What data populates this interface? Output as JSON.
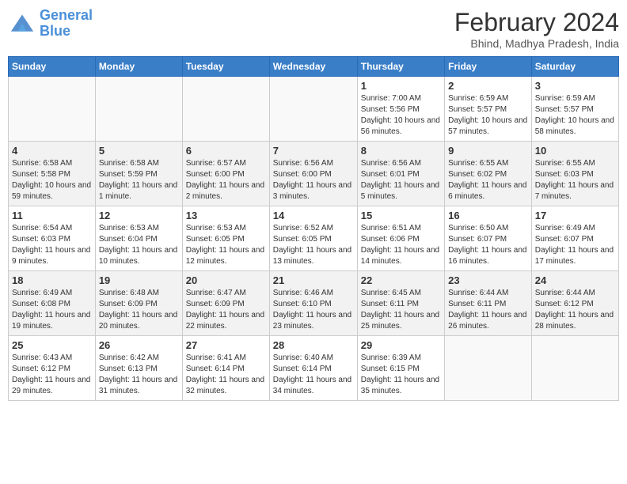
{
  "header": {
    "logo_line1": "General",
    "logo_line2": "Blue",
    "title": "February 2024",
    "subtitle": "Bhind, Madhya Pradesh, India"
  },
  "days_of_week": [
    "Sunday",
    "Monday",
    "Tuesday",
    "Wednesday",
    "Thursday",
    "Friday",
    "Saturday"
  ],
  "weeks": [
    [
      {
        "day": "",
        "info": ""
      },
      {
        "day": "",
        "info": ""
      },
      {
        "day": "",
        "info": ""
      },
      {
        "day": "",
        "info": ""
      },
      {
        "day": "1",
        "info": "Sunrise: 7:00 AM\nSunset: 5:56 PM\nDaylight: 10 hours and 56 minutes."
      },
      {
        "day": "2",
        "info": "Sunrise: 6:59 AM\nSunset: 5:57 PM\nDaylight: 10 hours and 57 minutes."
      },
      {
        "day": "3",
        "info": "Sunrise: 6:59 AM\nSunset: 5:57 PM\nDaylight: 10 hours and 58 minutes."
      }
    ],
    [
      {
        "day": "4",
        "info": "Sunrise: 6:58 AM\nSunset: 5:58 PM\nDaylight: 10 hours and 59 minutes."
      },
      {
        "day": "5",
        "info": "Sunrise: 6:58 AM\nSunset: 5:59 PM\nDaylight: 11 hours and 1 minute."
      },
      {
        "day": "6",
        "info": "Sunrise: 6:57 AM\nSunset: 6:00 PM\nDaylight: 11 hours and 2 minutes."
      },
      {
        "day": "7",
        "info": "Sunrise: 6:56 AM\nSunset: 6:00 PM\nDaylight: 11 hours and 3 minutes."
      },
      {
        "day": "8",
        "info": "Sunrise: 6:56 AM\nSunset: 6:01 PM\nDaylight: 11 hours and 5 minutes."
      },
      {
        "day": "9",
        "info": "Sunrise: 6:55 AM\nSunset: 6:02 PM\nDaylight: 11 hours and 6 minutes."
      },
      {
        "day": "10",
        "info": "Sunrise: 6:55 AM\nSunset: 6:03 PM\nDaylight: 11 hours and 7 minutes."
      }
    ],
    [
      {
        "day": "11",
        "info": "Sunrise: 6:54 AM\nSunset: 6:03 PM\nDaylight: 11 hours and 9 minutes."
      },
      {
        "day": "12",
        "info": "Sunrise: 6:53 AM\nSunset: 6:04 PM\nDaylight: 11 hours and 10 minutes."
      },
      {
        "day": "13",
        "info": "Sunrise: 6:53 AM\nSunset: 6:05 PM\nDaylight: 11 hours and 12 minutes."
      },
      {
        "day": "14",
        "info": "Sunrise: 6:52 AM\nSunset: 6:05 PM\nDaylight: 11 hours and 13 minutes."
      },
      {
        "day": "15",
        "info": "Sunrise: 6:51 AM\nSunset: 6:06 PM\nDaylight: 11 hours and 14 minutes."
      },
      {
        "day": "16",
        "info": "Sunrise: 6:50 AM\nSunset: 6:07 PM\nDaylight: 11 hours and 16 minutes."
      },
      {
        "day": "17",
        "info": "Sunrise: 6:49 AM\nSunset: 6:07 PM\nDaylight: 11 hours and 17 minutes."
      }
    ],
    [
      {
        "day": "18",
        "info": "Sunrise: 6:49 AM\nSunset: 6:08 PM\nDaylight: 11 hours and 19 minutes."
      },
      {
        "day": "19",
        "info": "Sunrise: 6:48 AM\nSunset: 6:09 PM\nDaylight: 11 hours and 20 minutes."
      },
      {
        "day": "20",
        "info": "Sunrise: 6:47 AM\nSunset: 6:09 PM\nDaylight: 11 hours and 22 minutes."
      },
      {
        "day": "21",
        "info": "Sunrise: 6:46 AM\nSunset: 6:10 PM\nDaylight: 11 hours and 23 minutes."
      },
      {
        "day": "22",
        "info": "Sunrise: 6:45 AM\nSunset: 6:11 PM\nDaylight: 11 hours and 25 minutes."
      },
      {
        "day": "23",
        "info": "Sunrise: 6:44 AM\nSunset: 6:11 PM\nDaylight: 11 hours and 26 minutes."
      },
      {
        "day": "24",
        "info": "Sunrise: 6:44 AM\nSunset: 6:12 PM\nDaylight: 11 hours and 28 minutes."
      }
    ],
    [
      {
        "day": "25",
        "info": "Sunrise: 6:43 AM\nSunset: 6:12 PM\nDaylight: 11 hours and 29 minutes."
      },
      {
        "day": "26",
        "info": "Sunrise: 6:42 AM\nSunset: 6:13 PM\nDaylight: 11 hours and 31 minutes."
      },
      {
        "day": "27",
        "info": "Sunrise: 6:41 AM\nSunset: 6:14 PM\nDaylight: 11 hours and 32 minutes."
      },
      {
        "day": "28",
        "info": "Sunrise: 6:40 AM\nSunset: 6:14 PM\nDaylight: 11 hours and 34 minutes."
      },
      {
        "day": "29",
        "info": "Sunrise: 6:39 AM\nSunset: 6:15 PM\nDaylight: 11 hours and 35 minutes."
      },
      {
        "day": "",
        "info": ""
      },
      {
        "day": "",
        "info": ""
      }
    ]
  ]
}
